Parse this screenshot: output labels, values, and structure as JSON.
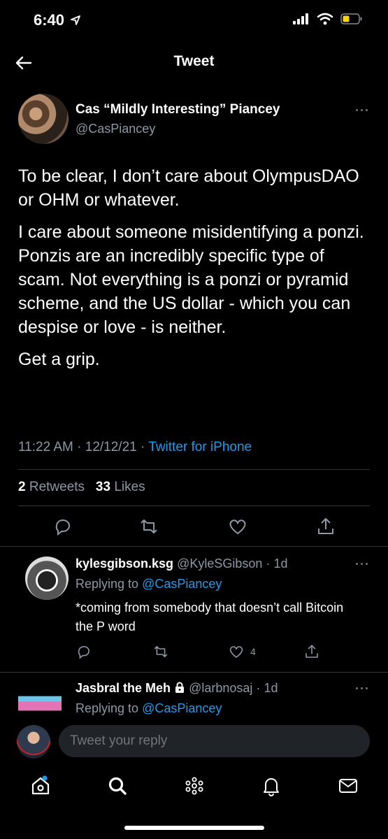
{
  "status_bar": {
    "time": "6:40"
  },
  "nav": {
    "title": "Tweet"
  },
  "tweet": {
    "author_name": "Cas “Mildly Interesting” Piancey",
    "author_handle": "@CasPiancey",
    "paragraphs": [
      "To be clear, I don’t care about OlympusDAO or OHM or whatever.",
      "I care about someone misidentifying a ponzi. Ponzis are an incredibly specific type of scam. Not everything is a ponzi or pyramid scheme, and the US dollar - which you can despise or love - is neither.",
      "Get a grip."
    ],
    "time": "11:22 AM",
    "date": "12/12/21",
    "source": "Twitter for iPhone",
    "retweets_count": "2",
    "retweets_label": "Retweets",
    "likes_count": "33",
    "likes_label": "Likes"
  },
  "replies": [
    {
      "name": "kylesgibson.ksg",
      "handle": "@KyleSGibson",
      "age": "1d",
      "replying_prefix": "Replying to",
      "replying_to": "@CasPiancey",
      "text": "*coming from somebody that doesn’t call Bitcoin the P word",
      "like_count": "4"
    },
    {
      "name": "Jasbral the Meh",
      "handle": "@larbnosaj",
      "age": "1d",
      "replying_prefix": "Replying to",
      "replying_to": "@CasPiancey"
    }
  ],
  "compose": {
    "placeholder": "Tweet your reply"
  },
  "colors": {
    "background": "#000000",
    "accent": "#1d9bf0",
    "secondary_text": "#8b98a5",
    "battery": "#f5d312"
  },
  "icons": [
    "back-arrow-icon",
    "more-icon",
    "reply-icon",
    "retweet-icon",
    "like-icon",
    "share-icon",
    "lock-icon",
    "home-icon",
    "search-icon",
    "spaces-icon",
    "notifications-icon",
    "messages-icon"
  ]
}
